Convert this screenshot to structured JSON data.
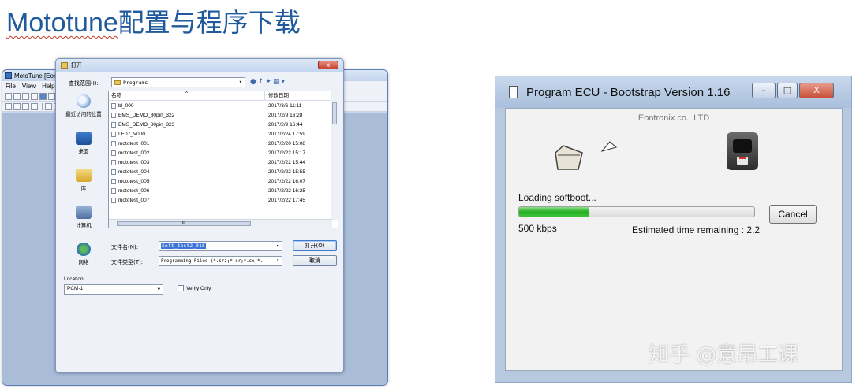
{
  "slide": {
    "title_latin": "Mototune",
    "title_cjk": "配置与程序下载"
  },
  "mototune": {
    "window_title": "MotoTune [Eontronix co., LTD]",
    "menu": [
      "File",
      "View",
      "Help"
    ]
  },
  "open_dialog": {
    "title": "打开",
    "close_glyph": "x",
    "look_in_label": "查找范围(I):",
    "look_in_value": "Programs",
    "places": [
      {
        "label": "最近访问的位置",
        "icon": "recent-places-icon"
      },
      {
        "label": "桌面",
        "icon": "desktop-icon"
      },
      {
        "label": "库",
        "icon": "library-icon"
      },
      {
        "label": "计算机",
        "icon": "computer-icon"
      },
      {
        "label": "网络",
        "icon": "network-icon"
      }
    ],
    "columns": {
      "name": "名称",
      "date": "修改日期"
    },
    "files": [
      {
        "name": "bl_000",
        "date": "2017/3/6 11:11"
      },
      {
        "name": "EMS_DEMO_80pin_322",
        "date": "2017/2/9 16:28"
      },
      {
        "name": "EMS_DEMO_80pin_323",
        "date": "2017/2/9 16:44"
      },
      {
        "name": "LE07_V000",
        "date": "2017/2/24 17:59"
      },
      {
        "name": "mototest_001",
        "date": "2017/2/20 15:08"
      },
      {
        "name": "mototest_002",
        "date": "2017/2/22 15:17"
      },
      {
        "name": "mototest_003",
        "date": "2017/2/22 15:44"
      },
      {
        "name": "mototest_004",
        "date": "2017/2/22 15:55"
      },
      {
        "name": "mototest_005",
        "date": "2017/2/22 16:07"
      },
      {
        "name": "mototest_006",
        "date": "2017/2/22 16:25"
      },
      {
        "name": "mototest_007",
        "date": "2017/2/22 17:45"
      }
    ],
    "hscroll_thumb": "III",
    "file_name_label": "文件名(N):",
    "file_name_value": "Soft_test2_018",
    "file_type_label": "文件类型(T):",
    "file_type_value": "Programming Files (*.srz;*.sr;*.sx;*.",
    "open_button": "打开(O)",
    "cancel_button": "取消",
    "location_label": "Location",
    "location_value": "PCM-1",
    "verify_only_label": "Verify Only"
  },
  "program_ecu": {
    "title": "Program ECU - Bootstrap Version 1.16",
    "company": "Eontronix co., LTD",
    "status": "Loading softboot...",
    "progress": 0.3,
    "speed": "500 kbps",
    "eta": "Estimated time remaining :  2.2",
    "cancel_button": "Cancel",
    "controls": {
      "minimize": "–",
      "maximize": "□",
      "close": "X"
    }
  },
  "watermark": "知乎 @意昂工课",
  "colors": {
    "title_blue": "#1f5a9c",
    "progress_green": "#24b023",
    "window_frame": "#b8c8de"
  }
}
